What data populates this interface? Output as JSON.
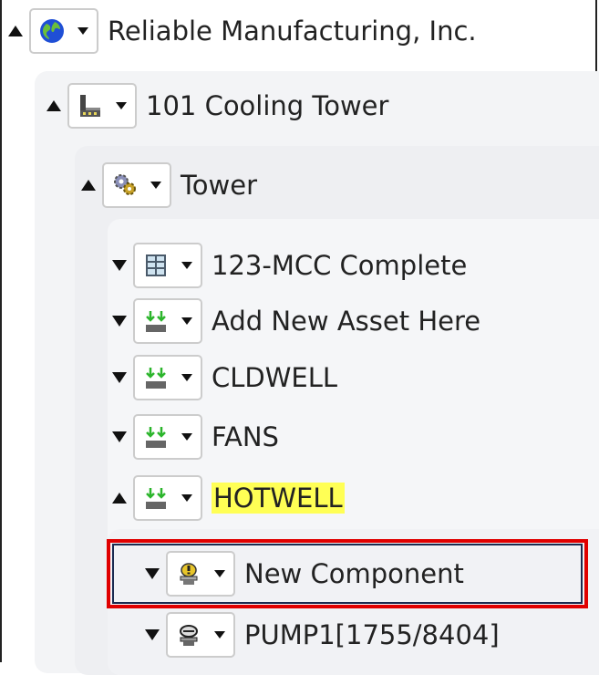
{
  "tree": {
    "root": {
      "label": "Reliable Manufacturing, Inc.",
      "icon": "globe-icon",
      "expanded": true
    },
    "site": {
      "label": "101 Cooling Tower",
      "icon": "factory-icon",
      "expanded": true
    },
    "system": {
      "label": "Tower",
      "icon": "gears-icon",
      "expanded": true
    },
    "assets": [
      {
        "label": "123-MCC Complete",
        "icon": "mcc-panel-icon",
        "expanded": false
      },
      {
        "label": "Add New Asset Here",
        "icon": "add-asset-icon",
        "expanded": false
      },
      {
        "label": "CLDWELL",
        "icon": "add-asset-icon",
        "expanded": false
      },
      {
        "label": "FANS",
        "icon": "add-asset-icon",
        "expanded": false
      },
      {
        "label": "HOTWELL",
        "icon": "add-asset-icon",
        "expanded": true,
        "highlighted": true
      }
    ],
    "components": [
      {
        "label": "New Component",
        "icon": "new-component-icon",
        "expanded": false,
        "selected": true
      },
      {
        "label": "PUMP1[1755/8404]",
        "icon": "pump-icon",
        "expanded": false
      }
    ]
  },
  "colors": {
    "highlight": "#ffff55",
    "selection_outer": "#e00000",
    "selection_inner": "#1a2a50",
    "panel_bg": "#f3f4f6"
  }
}
